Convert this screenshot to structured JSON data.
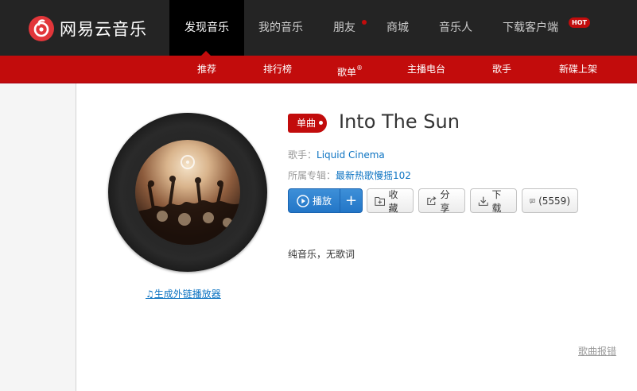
{
  "brand": {
    "name": "网易云音乐",
    "accent": "#c20c0c",
    "icon": "netease-logo-icon"
  },
  "nav": {
    "items": [
      {
        "label": "发现音乐"
      },
      {
        "label": "我的音乐"
      },
      {
        "label": "朋友"
      },
      {
        "label": "商城"
      },
      {
        "label": "音乐人"
      },
      {
        "label": "下载客户端"
      }
    ],
    "hot_badge": "HOT"
  },
  "subnav": {
    "items": [
      {
        "label": "推荐"
      },
      {
        "label": "排行榜"
      },
      {
        "label": "歌单"
      },
      {
        "label": "主播电台"
      },
      {
        "label": "歌手"
      },
      {
        "label": "新碟上架"
      }
    ],
    "playlist_mark": "®"
  },
  "song": {
    "tag": "单曲",
    "title": "Into The Sun",
    "artist_label": "歌手：",
    "artist": "Liquid Cinema",
    "album_label": "所属专辑：",
    "album": "最新热歌慢摇102",
    "lyric_note": "纯音乐，无歌词"
  },
  "actions": {
    "play": "播放",
    "add": "+",
    "collect": "收藏",
    "share": "分享",
    "download": "下载",
    "comments": "(5559)"
  },
  "links": {
    "generate_player": "生成外链播放器",
    "report": "歌曲报错"
  }
}
